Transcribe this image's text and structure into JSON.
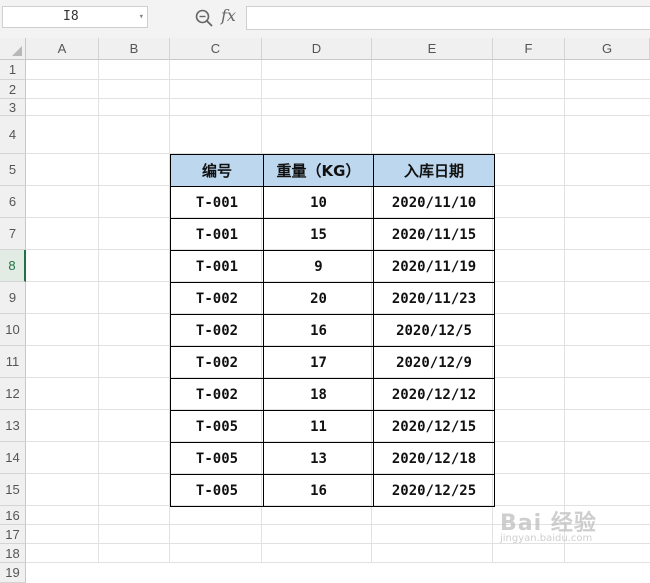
{
  "formula_bar": {
    "name_box": "I8",
    "fx_label": "fx",
    "formula": ""
  },
  "columns": [
    "A",
    "B",
    "C",
    "D",
    "E",
    "F",
    "G"
  ],
  "rows": [
    "1",
    "2",
    "3",
    "4",
    "5",
    "6",
    "7",
    "8",
    "9",
    "10",
    "11",
    "12",
    "13",
    "14",
    "15",
    "16",
    "17",
    "18",
    "19"
  ],
  "active_row": "8",
  "table": {
    "headers": [
      "编号",
      "重量（KG）",
      "入库日期"
    ],
    "rows": [
      [
        "T-001",
        "10",
        "2020/11/10"
      ],
      [
        "T-001",
        "15",
        "2020/11/15"
      ],
      [
        "T-001",
        "9",
        "2020/11/19"
      ],
      [
        "T-002",
        "20",
        "2020/11/23"
      ],
      [
        "T-002",
        "16",
        "2020/12/5"
      ],
      [
        "T-002",
        "17",
        "2020/12/9"
      ],
      [
        "T-002",
        "18",
        "2020/12/12"
      ],
      [
        "T-005",
        "11",
        "2020/12/15"
      ],
      [
        "T-005",
        "13",
        "2020/12/18"
      ],
      [
        "T-005",
        "16",
        "2020/12/25"
      ]
    ],
    "header_color": "#bdd7ee"
  },
  "watermark": {
    "main": "Bai 经验",
    "sub": "jingyan.baidu.com"
  }
}
